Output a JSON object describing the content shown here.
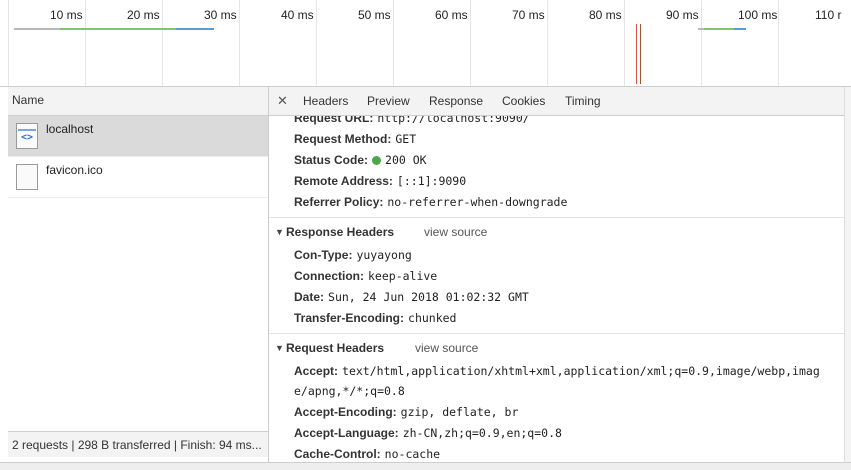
{
  "timeline": {
    "ticks": [
      "10 ms",
      "20 ms",
      "30 ms",
      "40 ms",
      "50 ms",
      "60 ms",
      "70 ms",
      "80 ms",
      "90 ms",
      "100 ms",
      "110 r"
    ]
  },
  "colors": {
    "bar_green": "#86c16c",
    "bar_blue": "#5b9bd5",
    "bar_gray": "#b8b8b8",
    "line_red": "#d9534f",
    "line_brown": "#a0522d"
  },
  "left": {
    "header": "Name",
    "rows": [
      {
        "label": "localhost",
        "icon": "html-document-icon"
      },
      {
        "label": "favicon.ico",
        "icon": "blank-file-icon"
      }
    ],
    "status": "2 requests | 298 B transferred | Finish: 94 ms..."
  },
  "tabs": [
    "Headers",
    "Preview",
    "Response",
    "Cookies",
    "Timing"
  ],
  "general": [
    {
      "key": "Request URL:",
      "value": "http://localhost:9090/"
    },
    {
      "key": "Request Method:",
      "value": "GET"
    },
    {
      "key": "Status Code:",
      "value": "200 OK"
    },
    {
      "key": "Remote Address:",
      "value": "[::1]:9090"
    },
    {
      "key": "Referrer Policy:",
      "value": "no-referrer-when-downgrade"
    }
  ],
  "response_headers": {
    "title": "Response Headers",
    "view_source": "view source",
    "items": [
      {
        "key": "Con-Type:",
        "value": "yuyayong"
      },
      {
        "key": "Connection:",
        "value": "keep-alive"
      },
      {
        "key": "Date:",
        "value": "Sun, 24 Jun 2018 01:02:32 GMT"
      },
      {
        "key": "Transfer-Encoding:",
        "value": "chunked"
      }
    ]
  },
  "request_headers": {
    "title": "Request Headers",
    "view_source": "view source",
    "accept_key": "Accept:",
    "accept_line1": "text/html,application/xhtml+xml,application/xml;q=0.9,image/webp,imag",
    "accept_line2": "e/apng,*/*;q=0.8",
    "items": [
      {
        "key": "Accept-Encoding:",
        "value": "gzip, deflate, br"
      },
      {
        "key": "Accept-Language:",
        "value": "zh-CN,zh;q=0.9,en;q=0.8"
      },
      {
        "key": "Cache-Control:",
        "value": "no-cache"
      }
    ]
  }
}
